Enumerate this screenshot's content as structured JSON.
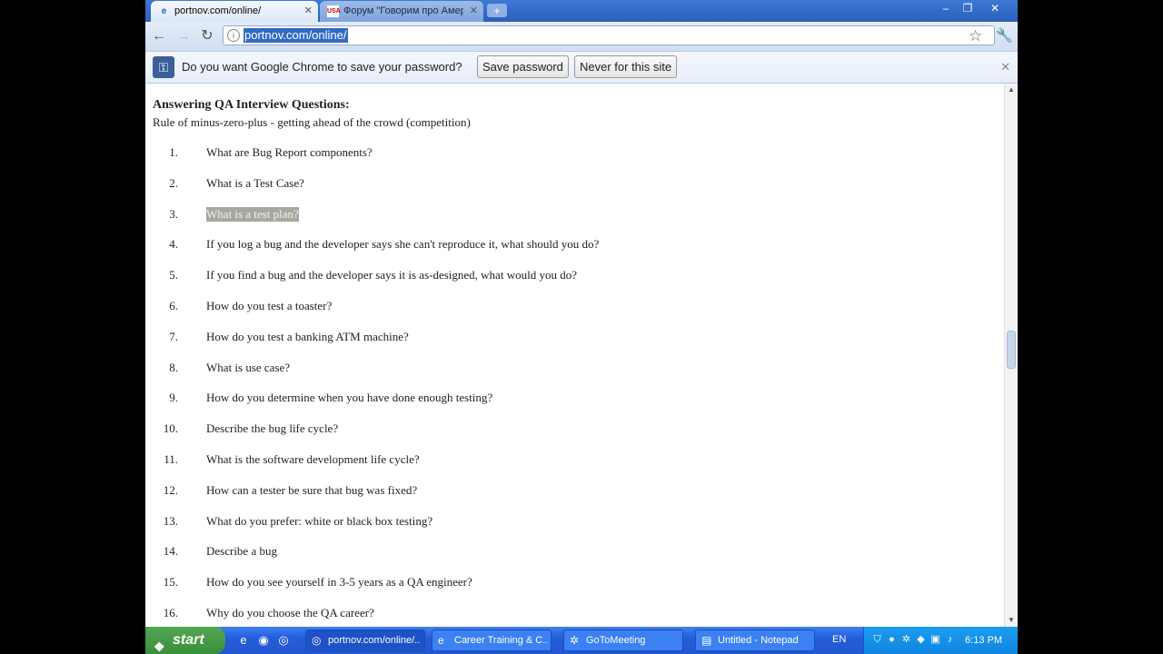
{
  "browser": {
    "tabs": [
      {
        "label": "portnov.com/online/",
        "favicon": "ie-icon",
        "active": true
      },
      {
        "label": "Форум \"Говорим про Америк",
        "favicon": "usa-flag-icon",
        "active": false
      }
    ],
    "address": "portnov.com/online/",
    "infobar": {
      "message": "Do you want Google Chrome to save your password?",
      "save_label": "Save password",
      "never_label": "Never for this site"
    }
  },
  "page": {
    "heading": "Answering QA Interview Questions:",
    "subheading": "Rule of minus-zero-plus - getting ahead of the crowd (competition)",
    "highlighted_index": 2,
    "questions": [
      {
        "num": "1.",
        "text": "What are Bug Report components?"
      },
      {
        "num": "2.",
        "text": "What is a Test Case?"
      },
      {
        "num": "3.",
        "text": "What is a test plan?"
      },
      {
        "num": "4.",
        "text": "If you log a bug and the developer says she can't reproduce it, what should you do?"
      },
      {
        "num": "5.",
        "text": "If you find a bug and the developer says it is as-designed, what would you do?"
      },
      {
        "num": "6.",
        "text": "How do you test a toaster?"
      },
      {
        "num": "7.",
        "text": "How do you test a banking ATM machine?"
      },
      {
        "num": "8.",
        "text": "What is use case?"
      },
      {
        "num": "9.",
        "text": "How do you determine when you have done enough testing?"
      },
      {
        "num": "10.",
        "text": "Describe the bug life cycle?"
      },
      {
        "num": "11.",
        "text": "What is the software development life cycle?"
      },
      {
        "num": "12.",
        "text": "How can a tester be sure that bug was fixed?"
      },
      {
        "num": "13.",
        "text": "What do you prefer: white or black box testing?"
      },
      {
        "num": "14.",
        "text": "Describe a bug"
      },
      {
        "num": "15.",
        "text": "How do you see yourself in 3-5 years as a QA engineer?"
      },
      {
        "num": "16.",
        "text": "Why do you choose the QA career?"
      }
    ]
  },
  "taskbar": {
    "start_label": "start",
    "buttons": [
      {
        "label": "portnov.com/online/...",
        "icon": "chrome-icon",
        "active": true
      },
      {
        "label": "Career Training & C...",
        "icon": "ie-icon",
        "active": false
      },
      {
        "label": "GoToMeeting",
        "icon": "gotomeeting-icon",
        "active": false
      },
      {
        "label": "Untitled - Notepad",
        "icon": "notepad-icon",
        "active": false
      }
    ],
    "language": "EN",
    "clock": "6:13 PM"
  }
}
